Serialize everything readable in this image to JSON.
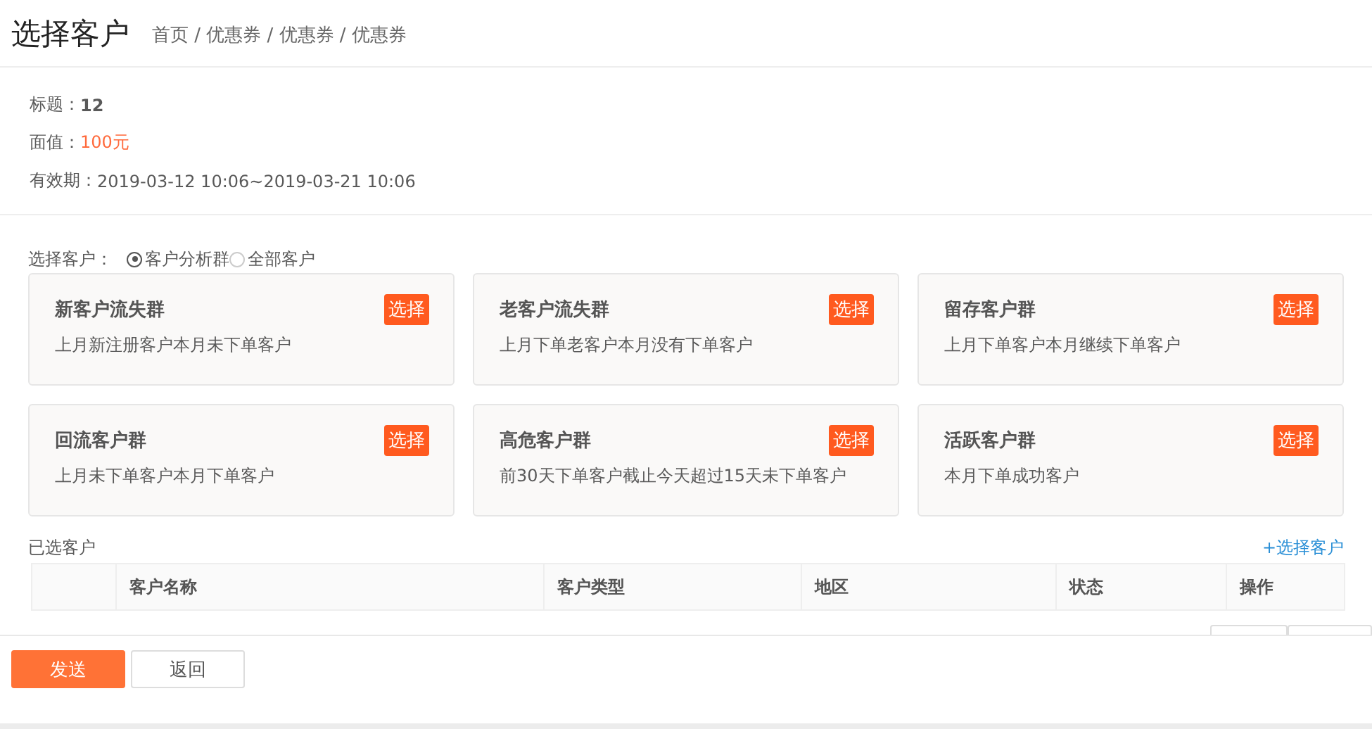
{
  "header": {
    "title": "选择客户",
    "breadcrumb": "首页 / 优惠券 / 优惠券 / 优惠券"
  },
  "info": [
    {
      "label": "标题：",
      "value": "12",
      "kind": "bold"
    },
    {
      "label": "面值：",
      "value": "100元",
      "kind": "price"
    },
    {
      "label": "有效期：",
      "value": "2019-03-12 10:06~2019-03-21 10:06",
      "kind": "plain"
    }
  ],
  "customer_choice": {
    "label": "选择客户：",
    "options": [
      {
        "label": "客户分析群",
        "selected": true
      },
      {
        "label": "全部客户",
        "selected": false
      }
    ]
  },
  "groups": [
    {
      "title": "新客户流失群",
      "description": "上月新注册客户本月未下单客户",
      "button": "选择"
    },
    {
      "title": "老客户流失群",
      "description": "上月下单老客户本月没有下单客户",
      "button": "选择"
    },
    {
      "title": "留存客户群",
      "description": "上月下单客户本月继续下单客户",
      "button": "选择"
    },
    {
      "title": "回流客户群",
      "description": "上月未下单客户本月下单客户",
      "button": "选择"
    },
    {
      "title": "高危客户群",
      "description": "前30天下单客户截止今天超过15天未下单客户",
      "button": "选择"
    },
    {
      "title": "活跃客户群",
      "description": "本月下单成功客户",
      "button": "选择"
    }
  ],
  "selected_customers": {
    "title": "已选客户",
    "add_link": "+选择客户"
  },
  "table": {
    "columns": [
      "客户名称",
      "客户类型",
      "地区",
      "状态",
      "操作"
    ]
  },
  "footer": {
    "buttons": [
      {
        "label": "发送",
        "kind": "primary"
      },
      {
        "label": "返回",
        "kind": "default"
      }
    ]
  }
}
